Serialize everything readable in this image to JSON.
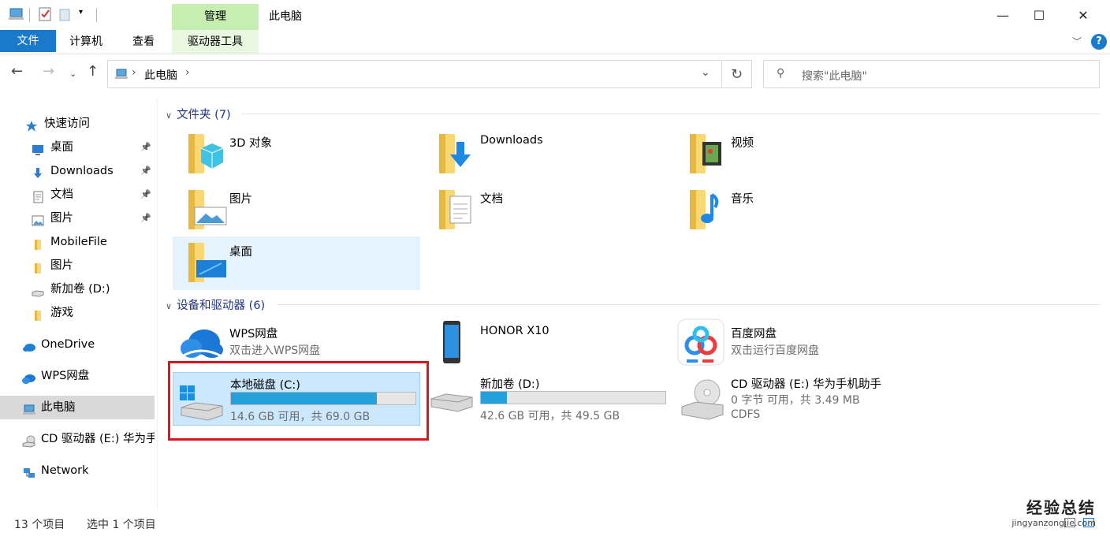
{
  "window": {
    "title": "此电脑",
    "context_tab": "管理",
    "context_subtab": "驱动器工具",
    "minimize": "—",
    "maximize": "☐",
    "close": "✕"
  },
  "ribbon": {
    "tabs": [
      "文件",
      "计算机",
      "查看"
    ]
  },
  "address": {
    "path": "此电脑",
    "search_placeholder": "搜索\"此电脑\""
  },
  "sidebar": {
    "items": [
      {
        "label": "快速访问",
        "icon": "star-icon",
        "pinned": false
      },
      {
        "label": "桌面",
        "icon": "desktop-icon",
        "pinned": true
      },
      {
        "label": "Downloads",
        "icon": "download-icon",
        "pinned": true
      },
      {
        "label": "文档",
        "icon": "document-icon",
        "pinned": true
      },
      {
        "label": "图片",
        "icon": "picture-icon",
        "pinned": true
      },
      {
        "label": "MobileFile",
        "icon": "folder-icon",
        "pinned": false
      },
      {
        "label": "图片",
        "icon": "folder-icon",
        "pinned": false
      },
      {
        "label": "新加卷 (D:)",
        "icon": "drive-icon",
        "pinned": false
      },
      {
        "label": "游戏",
        "icon": "folder-icon",
        "pinned": false
      },
      {
        "label": "OneDrive",
        "icon": "cloud-icon",
        "pinned": false
      },
      {
        "label": "WPS网盘",
        "icon": "wps-cloud-icon",
        "pinned": false
      },
      {
        "label": "此电脑",
        "icon": "computer-icon",
        "pinned": false,
        "selected": true
      },
      {
        "label": "CD 驱动器 (E:) 华为手",
        "icon": "cd-icon",
        "pinned": false
      },
      {
        "label": "Network",
        "icon": "network-icon",
        "pinned": false
      }
    ]
  },
  "folders_group": {
    "title": "文件夹 (7)",
    "items": [
      "3D 对象",
      "Downloads",
      "视频",
      "图片",
      "文档",
      "音乐",
      "桌面"
    ]
  },
  "devices_group": {
    "title": "设备和驱动器 (6)"
  },
  "devices": {
    "wps": {
      "name": "WPS网盘",
      "desc": "双击进入WPS网盘"
    },
    "honor": {
      "name": "HONOR X10"
    },
    "baidu": {
      "name": "百度网盘",
      "desc": "双击运行百度网盘"
    },
    "c": {
      "name": "本地磁盘 (C:)",
      "space": "14.6 GB 可用，共 69.0 GB",
      "used_fraction": 0.79
    },
    "d": {
      "name": "新加卷 (D:)",
      "space": "42.6 GB 可用，共 49.5 GB",
      "used_fraction": 0.14
    },
    "e": {
      "name": "CD 驱动器 (E:) 华为手机助手",
      "space": "0 字节 可用，共 3.49 MB",
      "fs": "CDFS"
    }
  },
  "status": {
    "count": "13 个项目",
    "selected": "选中 1 个项目"
  },
  "watermark": {
    "line1": "经验总结",
    "line2": "jingyanzongjie.com"
  },
  "colors": {
    "accent": "#1979ca",
    "bar": "#26a0da",
    "highlight": "#e0141e",
    "selection": "#cce8ff"
  }
}
